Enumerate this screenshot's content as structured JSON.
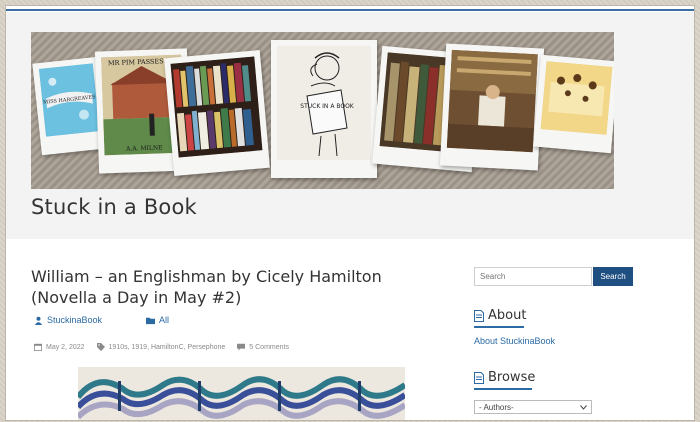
{
  "site": {
    "title": "Stuck in a Book"
  },
  "post": {
    "title": "William – an Englishman by Cicely Hamilton (Novella a Day in May #2)",
    "author": "StuckinaBook",
    "category": "All",
    "date": "May 2, 2022",
    "tags": "1910s, 1919, HamiltonC, Persephone",
    "comments": "5 Comments"
  },
  "sidebar": {
    "search": {
      "placeholder": "Search",
      "button_label": "Search"
    },
    "about": {
      "title": "About",
      "link_label": "About StuckinaBook"
    },
    "browse": {
      "title": "Browse",
      "select_value": "- Authors-"
    }
  },
  "banner": {
    "book_titles": [
      "MISS HARGREAVES",
      "MR PIM PASSES BY",
      "A.A. MILNE",
      "STUCK IN A BOOK"
    ]
  },
  "colors": {
    "accent": "#1e4f80",
    "link": "#2b6aa3",
    "top_rule": "#3b6fa3"
  }
}
